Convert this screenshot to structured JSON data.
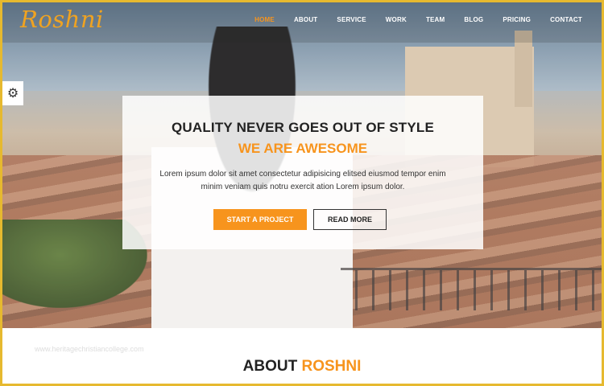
{
  "brand": {
    "logo": "Roshni"
  },
  "nav": {
    "items": [
      "HOME",
      "ABOUT",
      "SERVICE",
      "WORK",
      "TEAM",
      "BLOG",
      "PRICING",
      "CONTACT"
    ],
    "active_index": 0
  },
  "hero": {
    "title": "QUALITY NEVER GOES OUT OF STYLE",
    "subtitle": "WE ARE AWESOME",
    "description": "Lorem ipsum dolor sit amet consectetur adipisicing elitsed eiusmod tempor enim minim veniam quis notru exercit ation Lorem ipsum dolor.",
    "primary_button": "START A PROJECT",
    "secondary_button": "READ MORE"
  },
  "settings": {
    "icon": "gear-icon"
  },
  "watermark": "www.heritagechristiancollege.com",
  "about": {
    "prefix": "ABOUT",
    "accent": "ROSHNI"
  },
  "colors": {
    "accent": "#f7941d",
    "frame": "#e6b92f"
  }
}
